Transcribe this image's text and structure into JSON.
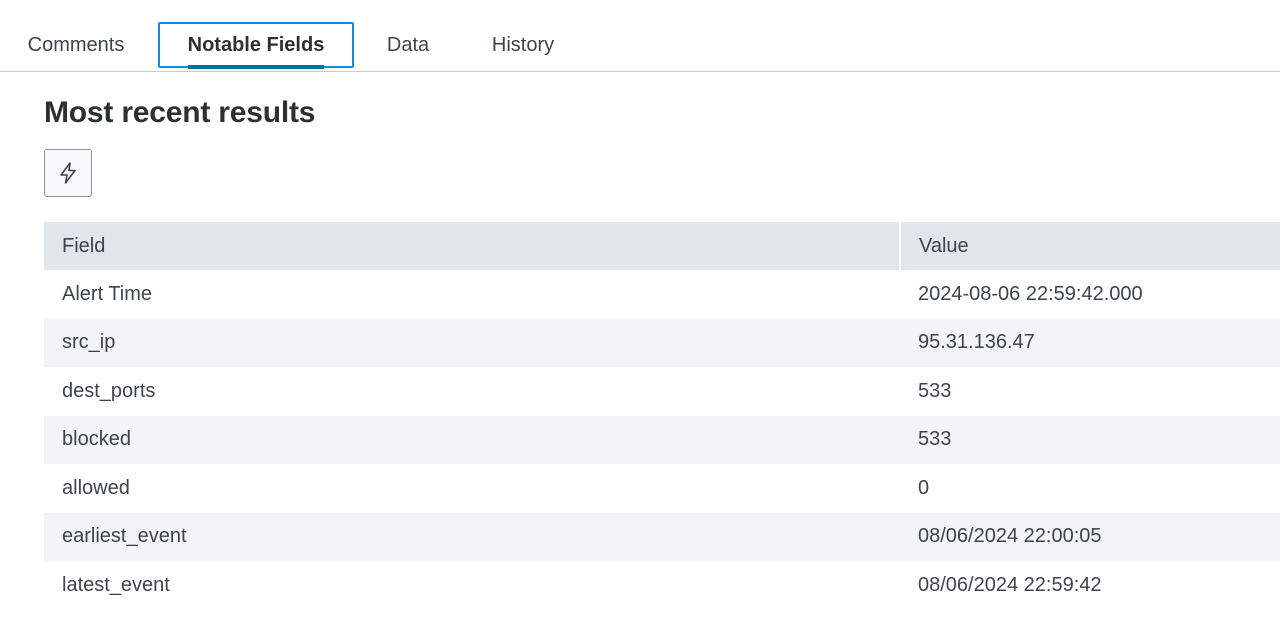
{
  "tabs": [
    {
      "label": "Comments",
      "active": false
    },
    {
      "label": "Notable Fields",
      "active": true
    },
    {
      "label": "Data",
      "active": false
    },
    {
      "label": "History",
      "active": false
    }
  ],
  "section": {
    "title": "Most recent results",
    "action_icon": "lightning-bolt-icon"
  },
  "table": {
    "headers": [
      "Field",
      "Value"
    ],
    "rows": [
      {
        "field": "Alert Time",
        "value": "2024-08-06 22:59:42.000"
      },
      {
        "field": "src_ip",
        "value": "95.31.136.47"
      },
      {
        "field": "dest_ports",
        "value": "533"
      },
      {
        "field": "blocked",
        "value": "533"
      },
      {
        "field": "allowed",
        "value": "0"
      },
      {
        "field": "earliest_event",
        "value": "08/06/2024 22:00:05"
      },
      {
        "field": "latest_event",
        "value": "08/06/2024 22:59:42"
      }
    ]
  },
  "colors": {
    "active_tab_underline": "#006eaa",
    "focus_ring": "#1a8cd8",
    "header_bg": "#e1e6eb",
    "alt_row_bg": "#f2f4f5"
  }
}
